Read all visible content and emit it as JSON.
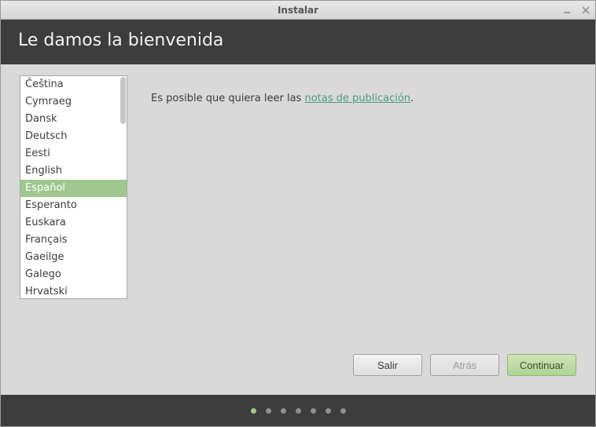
{
  "window": {
    "title": "Instalar"
  },
  "banner": {
    "heading": "Le damos la bienvenida"
  },
  "languages": {
    "items": [
      "Čeština",
      "Cymraeg",
      "Dansk",
      "Deutsch",
      "Eesti",
      "English",
      "Español",
      "Esperanto",
      "Euskara",
      "Français",
      "Gaeilge",
      "Galego",
      "Hrvatski"
    ],
    "selected_index": 6
  },
  "info": {
    "prefix": "Es posible que quiera leer las ",
    "link_text": "notas de publicación",
    "suffix": "."
  },
  "buttons": {
    "quit": "Salir",
    "back": "Atrás",
    "continue": "Continuar"
  },
  "progress": {
    "count": 7,
    "active_index": 0
  }
}
